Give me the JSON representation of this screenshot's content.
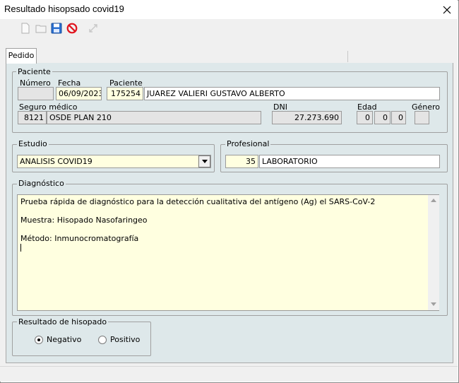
{
  "window": {
    "title": "Resultado hisopsado covid19",
    "close_glyph": "✕"
  },
  "toolbar": {
    "buttons": [
      {
        "icon": "new-document-icon",
        "enabled": false
      },
      {
        "icon": "open-folder-icon",
        "enabled": false
      },
      {
        "icon": "save-icon",
        "enabled": true
      },
      {
        "icon": "cancel-icon",
        "enabled": true
      },
      {
        "icon": "resize-icon",
        "enabled": false
      }
    ]
  },
  "tabs": [
    {
      "label": "Pedido",
      "active": true
    }
  ],
  "paciente": {
    "group_label": "Paciente",
    "numero_label": "Número",
    "numero_value": "",
    "fecha_label": "Fecha",
    "fecha_value": "06/09/2023",
    "paciente_label": "Paciente",
    "paciente_id": "175254",
    "paciente_nombre": "JUAREZ VALIERI GUSTAVO ALBERTO",
    "seguro_label": "Seguro médico",
    "seguro_codigo": "8121",
    "seguro_nombre": "OSDE PLAN 210",
    "dni_label": "DNI",
    "dni_value": "27.273.690",
    "edad_label": "Edad",
    "edad_values": [
      "0",
      "0",
      "0"
    ],
    "genero_label": "Género",
    "genero_value": ""
  },
  "estudio": {
    "group_label": "Estudio",
    "selected": "ANALISIS COVID19"
  },
  "profesional": {
    "group_label": "Profesional",
    "codigo": "35",
    "nombre": "LABORATORIO"
  },
  "diagnostico": {
    "group_label": "Diagnóstico",
    "text": "Prueba rápida de diagnóstico para la detección cualitativa del antígeno (Ag) el SARS-CoV-2\n\nMuestra: Hisopado Nasofaringeo\n\nMétodo: Inmunocromatografía\n"
  },
  "resultado": {
    "group_label": "Resultado de hisopado",
    "options": [
      {
        "label": "Negativo",
        "checked": true
      },
      {
        "label": "Positivo",
        "checked": false
      }
    ]
  },
  "colors": {
    "panel": "#dee8ea",
    "input_yellow": "#ffffe0",
    "readonly": "#e4e4e4"
  }
}
